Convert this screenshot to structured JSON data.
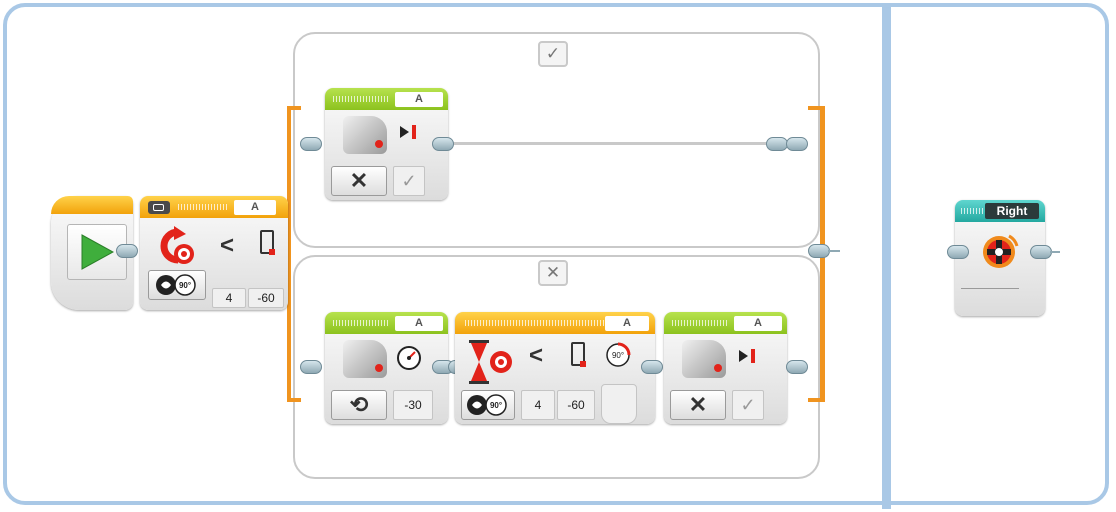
{
  "switch": {
    "true_case_icon": "check-icon",
    "false_case_icon": "x-icon",
    "true_case_glyph": "✓",
    "false_case_glyph": "✕"
  },
  "start_block": {
    "icon": "play-icon"
  },
  "condition_block": {
    "port": "A",
    "compare_operator": "<",
    "value_a": "4",
    "value_b": "-60",
    "icons": [
      "motor-rotation-compare-icon",
      "degrees-mode-icon",
      "threshold-icon"
    ]
  },
  "true_case": {
    "motor_stop": {
      "port": "A",
      "mode_glyph": "✕",
      "brake_glyph": "✓",
      "icons": [
        "medium-motor-icon",
        "stop-icon"
      ]
    }
  },
  "false_case": {
    "motor_on": {
      "port": "A",
      "mode_glyph": "⟲",
      "power": "-30",
      "icons": [
        "medium-motor-icon",
        "speedometer-icon"
      ]
    },
    "wait_block": {
      "port": "A",
      "compare_operator": "<",
      "value_a": "4",
      "value_b": "-60",
      "icons": [
        "hourglass-icon",
        "motor-rotation-icon",
        "threshold-icon",
        "degrees-output-icon"
      ]
    },
    "motor_stop": {
      "port": "A",
      "mode_glyph": "✕",
      "brake_glyph": "✓",
      "icons": [
        "medium-motor-icon",
        "stop-icon"
      ]
    }
  },
  "myblock": {
    "label": "Right",
    "icon": "motor-rotate-icon"
  },
  "colors": {
    "sequence_wire": "#f0941f",
    "frame": "#a9c8e6",
    "motor_header": "#8cc21e",
    "flow_header": "#f2a20b",
    "myblock_header": "#23a8a0"
  }
}
